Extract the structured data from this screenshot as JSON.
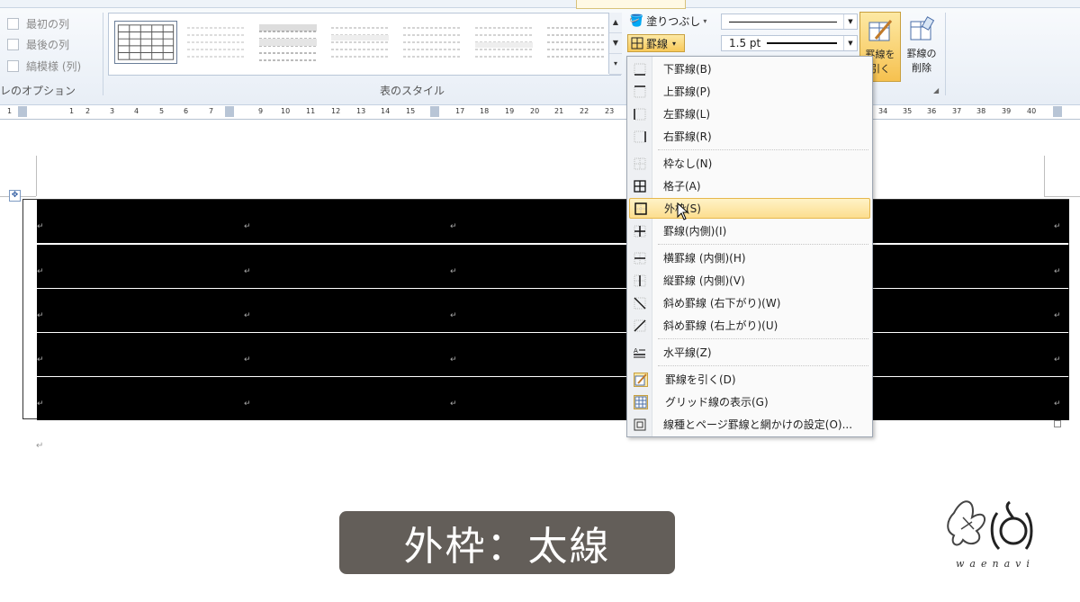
{
  "ribbon": {
    "table_style_options": {
      "group_label": "レのオプション",
      "items": [
        {
          "label": "最初の列",
          "checked": false
        },
        {
          "label": "最後の列",
          "checked": false
        },
        {
          "label": "縞模様 (列)",
          "checked": false
        }
      ]
    },
    "table_styles": {
      "group_label": "表のスタイル"
    },
    "shading_label": "塗りつぶし",
    "borders_label": "罫線",
    "line_weight": "1.5 pt",
    "draw_table_label": "罫線を引く",
    "draw_table_label_line1": "罫線を",
    "draw_table_label_line2": "引く",
    "eraser_label_line1": "罫線の",
    "eraser_label_line2": "削除"
  },
  "ruler": {
    "left_numbers": [
      "1",
      "1",
      "2",
      "3",
      "4",
      "5",
      "6",
      "7"
    ],
    "mid_numbers": [
      "9",
      "10",
      "11",
      "12",
      "13",
      "14",
      "15"
    ],
    "right_numbers": [
      "17",
      "18",
      "19",
      "20",
      "21",
      "22",
      "23"
    ],
    "far_numbers": [
      "34",
      "35",
      "36",
      "37",
      "38",
      "39",
      "40"
    ]
  },
  "borders_menu": {
    "items": [
      {
        "label": "下罫線(B)",
        "icon": "border-bottom-icon"
      },
      {
        "label": "上罫線(P)",
        "icon": "border-top-icon"
      },
      {
        "label": "左罫線(L)",
        "icon": "border-left-icon"
      },
      {
        "label": "右罫線(R)",
        "icon": "border-right-icon"
      },
      {
        "label": "枠なし(N)",
        "icon": "no-border-icon"
      },
      {
        "label": "格子(A)",
        "icon": "all-borders-icon"
      },
      {
        "label": "外枠(S)",
        "icon": "outside-borders-icon",
        "highlighted": true
      },
      {
        "label": "罫線(内側)(I)",
        "icon": "inside-borders-icon"
      },
      {
        "label": "横罫線 (内側)(H)",
        "icon": "inside-horizontal-border-icon"
      },
      {
        "label": "縦罫線 (内側)(V)",
        "icon": "inside-vertical-border-icon"
      },
      {
        "label": "斜め罫線 (右下がり)(W)",
        "icon": "diagonal-down-border-icon"
      },
      {
        "label": "斜め罫線 (右上がり)(U)",
        "icon": "diagonal-up-border-icon"
      },
      {
        "label": "水平線(Z)",
        "icon": "horizontal-line-icon"
      },
      {
        "label": "罫線を引く(D)",
        "icon": "draw-table-icon"
      },
      {
        "label": "グリッド線の表示(G)",
        "icon": "view-gridlines-icon"
      },
      {
        "label": "線種とページ罫線と網かけの設定(O)...",
        "icon": "borders-shading-icon"
      }
    ]
  },
  "table": {
    "cell_mark": "↵",
    "rows": 5,
    "cols": 5
  },
  "document": {
    "paragraph_mark": "↵"
  },
  "caption": "外枠：太線",
  "logo_text": "waenavi",
  "colors": {
    "highlight": "#fcde8f",
    "caption_bg": "#635e59",
    "table_fill": "#000000"
  }
}
